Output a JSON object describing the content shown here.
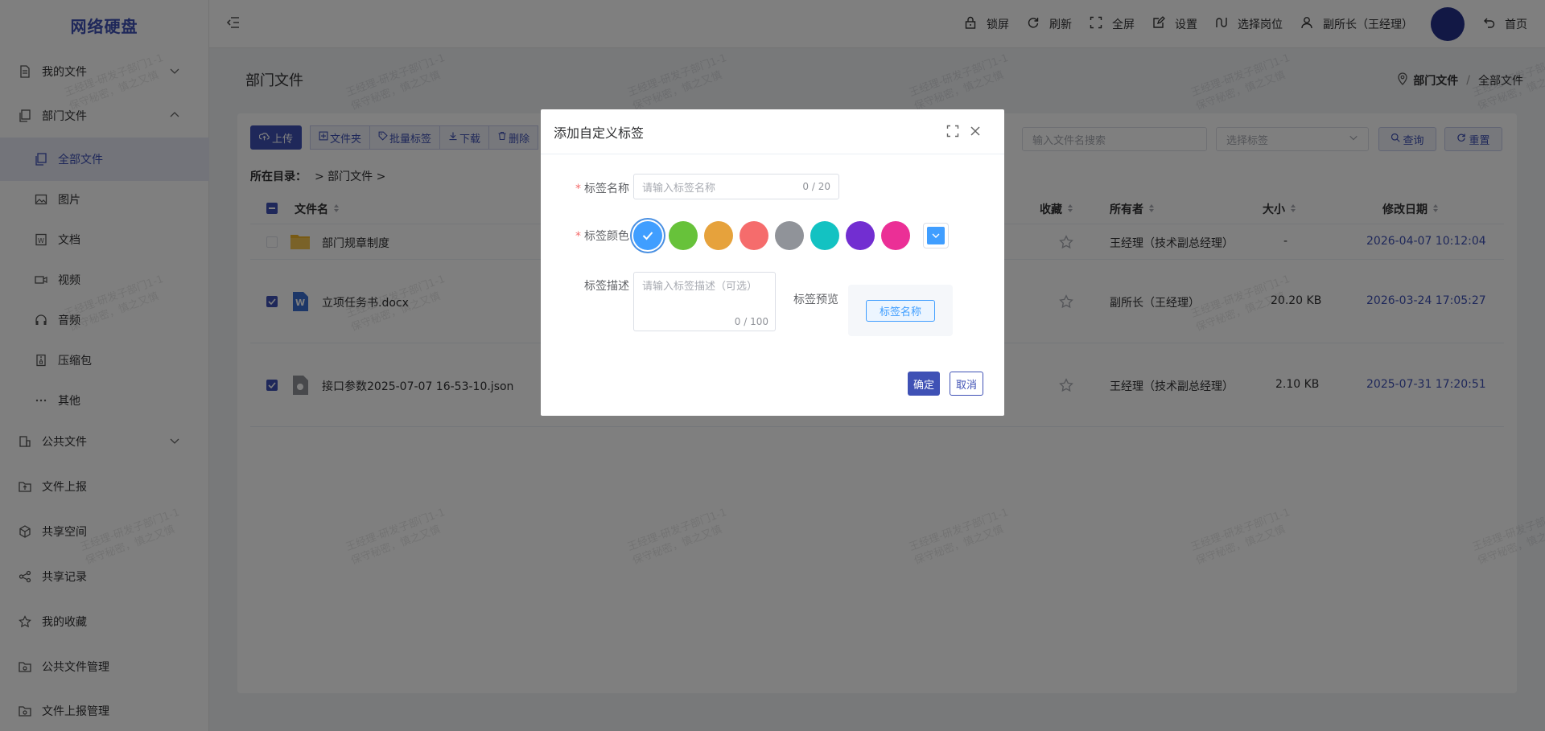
{
  "sidebar": {
    "logo": "网络硬盘",
    "items": [
      {
        "label": "我的文件",
        "icon": "file-icon"
      },
      {
        "label": "部门文件",
        "icon": "files-icon"
      },
      {
        "label": "全部文件",
        "icon": "files-icon"
      },
      {
        "label": "图片",
        "icon": "image-icon"
      },
      {
        "label": "文档",
        "icon": "document-icon"
      },
      {
        "label": "视频",
        "icon": "video-icon"
      },
      {
        "label": "音频",
        "icon": "headphones-icon"
      },
      {
        "label": "压缩包",
        "icon": "archive-icon"
      },
      {
        "label": "其他",
        "icon": "more-icon"
      },
      {
        "label": "公共文件",
        "icon": "building-icon"
      },
      {
        "label": "文件上报",
        "icon": "upload-folder-icon"
      },
      {
        "label": "共享空间",
        "icon": "cube-icon"
      },
      {
        "label": "共享记录",
        "icon": "share-icon"
      },
      {
        "label": "我的收藏",
        "icon": "star-icon"
      },
      {
        "label": "公共文件管理",
        "icon": "folder-manage-icon"
      },
      {
        "label": "文件上报管理",
        "icon": "folder-manage-icon"
      }
    ]
  },
  "topbar": {
    "lock": "锁屏",
    "refresh": "刷新",
    "fullscreen": "全屏",
    "settings": "设置",
    "select_post": "选择岗位",
    "user": "副所长（王经理）",
    "home": "首页"
  },
  "page": {
    "title": "部门文件",
    "breadcrumb": [
      "部门文件",
      "全部文件"
    ]
  },
  "toolbar": {
    "upload": "上传",
    "folder": "文件夹",
    "batch_tag": "批量标签",
    "download": "下载",
    "delete": "删除",
    "search_placeholder": "输入文件名搜索",
    "tag_placeholder": "选择标签",
    "query": "查询",
    "reset": "重置"
  },
  "path": {
    "label": "所在目录：",
    "value": "> 部门文件 >"
  },
  "table": {
    "headers": {
      "name": "文件名",
      "favorite": "收藏",
      "owner": "所有者",
      "size": "大小",
      "modified": "修改日期"
    },
    "rows": [
      {
        "name": "部门规章制度",
        "owner": "王经理（技术副总经理）",
        "size": "-",
        "modified": "2026-04-07 10:12:04",
        "checked": false
      },
      {
        "name": "立项任务书.docx",
        "owner": "副所长（王经理）",
        "size": "20.20 KB",
        "modified": "2026-03-24 17:05:27",
        "checked": true
      },
      {
        "name": "接口参数2025-07-07 16-53-10.json",
        "owner": "王经理（技术副总经理）",
        "size": "2.10 KB",
        "modified": "2025-07-31 17:20:51",
        "checked": true
      }
    ]
  },
  "watermark": {
    "line1": "王经理-研发子部门1-1",
    "line2": "保守秘密，慎之又慎"
  },
  "dialog": {
    "title": "添加自定义标签",
    "name_label": "标签名称",
    "name_placeholder": "请输入标签名称",
    "name_counter": "0 / 20",
    "color_label": "标签颜色",
    "colors": [
      "#409eff",
      "#67c23a",
      "#e6a23c",
      "#f56c6c",
      "#909399",
      "#13c2c2",
      "#722ed1",
      "#eb2f96"
    ],
    "desc_label": "标签描述",
    "desc_placeholder": "请输入标签描述（可选）",
    "desc_counter": "0 / 100",
    "preview_label": "标签预览",
    "preview_tag": "标签名称",
    "confirm": "确定",
    "cancel": "取消"
  }
}
